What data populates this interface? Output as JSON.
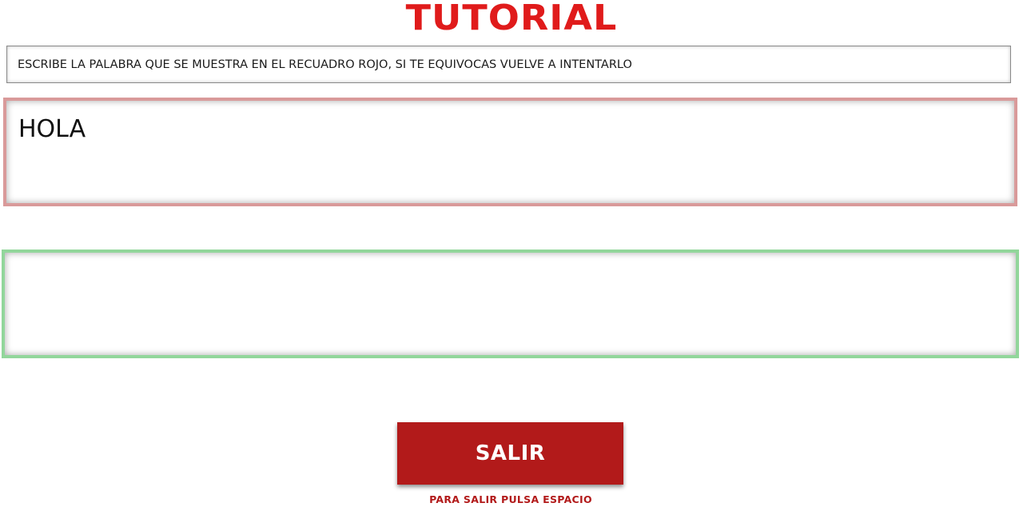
{
  "header": {
    "title": "TUTORIAL"
  },
  "instructions": {
    "text": "ESCRIBE LA PALABRA QUE SE MUESTRA EN EL RECUADRO ROJO, SI TE EQUIVOCAS VUELVE A INTENTARLO"
  },
  "target": {
    "word": "HOLA",
    "border_color": "#d99a9a"
  },
  "answer": {
    "value": "",
    "placeholder": "",
    "border_color": "#92d69b"
  },
  "footer": {
    "exit_label": "SALIR",
    "exit_hint": "PARA SALIR PULSA ESPACIO",
    "accent_color": "#b21a1a",
    "title_color": "#e01b1b"
  }
}
